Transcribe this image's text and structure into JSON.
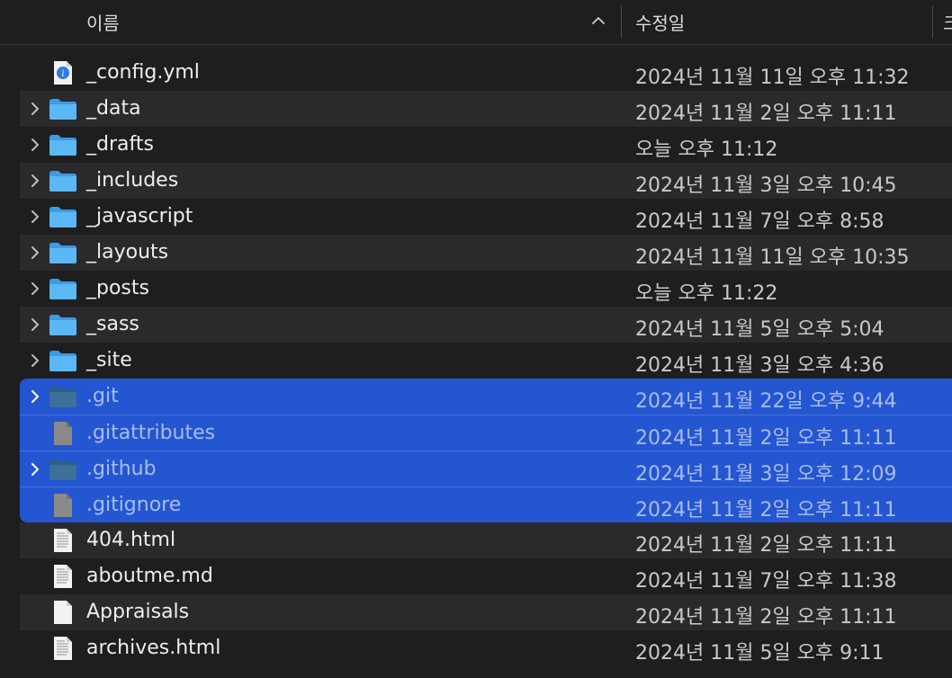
{
  "header": {
    "name_label": "이름",
    "date_label": "수정일",
    "clipped_label": "크"
  },
  "files": [
    {
      "name": "_config.yml",
      "date": "2024년 11월 11일 오후 11:32",
      "kind": "yml",
      "expandable": false,
      "selected": false
    },
    {
      "name": "_data",
      "date": "2024년 11월 2일 오후 11:11",
      "kind": "folder",
      "expandable": true,
      "selected": false
    },
    {
      "name": "_drafts",
      "date": "오늘 오후 11:12",
      "kind": "folder",
      "expandable": true,
      "selected": false
    },
    {
      "name": "_includes",
      "date": "2024년 11월 3일 오후 10:45",
      "kind": "folder",
      "expandable": true,
      "selected": false
    },
    {
      "name": "_javascript",
      "date": "2024년 11월 7일 오후 8:58",
      "kind": "folder",
      "expandable": true,
      "selected": false
    },
    {
      "name": "_layouts",
      "date": "2024년 11월 11일 오후 10:35",
      "kind": "folder",
      "expandable": true,
      "selected": false
    },
    {
      "name": "_posts",
      "date": "오늘 오후 11:22",
      "kind": "folder",
      "expandable": true,
      "selected": false
    },
    {
      "name": "_sass",
      "date": "2024년 11월 5일 오후 5:04",
      "kind": "folder",
      "expandable": true,
      "selected": false
    },
    {
      "name": "_site",
      "date": "2024년 11월 3일 오후 4:36",
      "kind": "folder",
      "expandable": true,
      "selected": false
    },
    {
      "name": ".git",
      "date": "2024년 11월 22일 오후 9:44",
      "kind": "hidden-folder",
      "expandable": true,
      "selected": true
    },
    {
      "name": ".gitattributes",
      "date": "2024년 11월 2일 오후 11:11",
      "kind": "hidden-file",
      "expandable": false,
      "selected": true
    },
    {
      "name": ".github",
      "date": "2024년 11월 3일 오후 12:09",
      "kind": "hidden-folder",
      "expandable": true,
      "selected": true
    },
    {
      "name": ".gitignore",
      "date": "2024년 11월 2일 오후 11:11",
      "kind": "hidden-file",
      "expandable": false,
      "selected": true
    },
    {
      "name": "404.html",
      "date": "2024년 11월 2일 오후 11:11",
      "kind": "text-doc",
      "expandable": false,
      "selected": false
    },
    {
      "name": "aboutme.md",
      "date": "2024년 11월 7일 오후 11:38",
      "kind": "text-doc",
      "expandable": false,
      "selected": false
    },
    {
      "name": "Appraisals",
      "date": "2024년 11월 2일 오후 11:11",
      "kind": "blank-doc",
      "expandable": false,
      "selected": false
    },
    {
      "name": "archives.html",
      "date": "2024년 11월 5일 오후 9:11",
      "kind": "text-doc",
      "expandable": false,
      "selected": false
    }
  ]
}
